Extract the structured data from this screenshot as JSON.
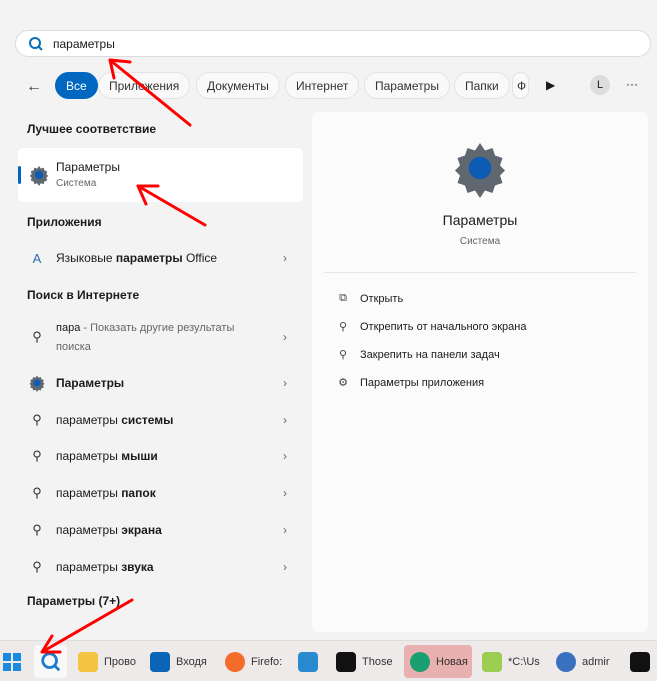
{
  "search": {
    "value": "параметры"
  },
  "filters": {
    "back": "←",
    "chips": [
      "Все",
      "Приложения",
      "Документы",
      "Интернет",
      "Параметры",
      "Папки",
      "Ф"
    ],
    "play": "▶",
    "avatar": "L",
    "more": "···"
  },
  "best": {
    "heading": "Лучшее соответствие",
    "title": "Параметры",
    "subtitle": "Система"
  },
  "apps": {
    "heading": "Приложения",
    "item_pre": "Языковые ",
    "item_bold": "параметры",
    "item_post": " Office"
  },
  "web": {
    "heading": "Поиск в Интернете",
    "first_bold": "пара",
    "first_rest": " - Показать другие результаты",
    "first_line2": "поиска",
    "items": [
      {
        "pre": "",
        "bold": "Параметры",
        "icon": "gear"
      },
      {
        "pre": "параметры ",
        "bold": "системы",
        "icon": "search"
      },
      {
        "pre": "параметры ",
        "bold": "мыши",
        "icon": "search"
      },
      {
        "pre": "параметры ",
        "bold": "папок",
        "icon": "search"
      },
      {
        "pre": "параметры ",
        "bold": "экрана",
        "icon": "search"
      },
      {
        "pre": "параметры ",
        "bold": "звука",
        "icon": "search"
      }
    ]
  },
  "settings_heading": "Параметры (7+)",
  "detail": {
    "title": "Параметры",
    "subtitle": "Система",
    "actions": [
      "Открыть",
      "Открепить от начального экрана",
      "Закрепить на панели задач",
      "Параметры приложения"
    ]
  },
  "taskbar": {
    "items": [
      "Прово",
      "Входя",
      "Firefo:",
      "",
      "Those",
      "Новая",
      "*C:\\Us",
      "admir",
      ""
    ]
  },
  "colors": {
    "accent": "#0067c0",
    "arrow": "#ff0000"
  }
}
